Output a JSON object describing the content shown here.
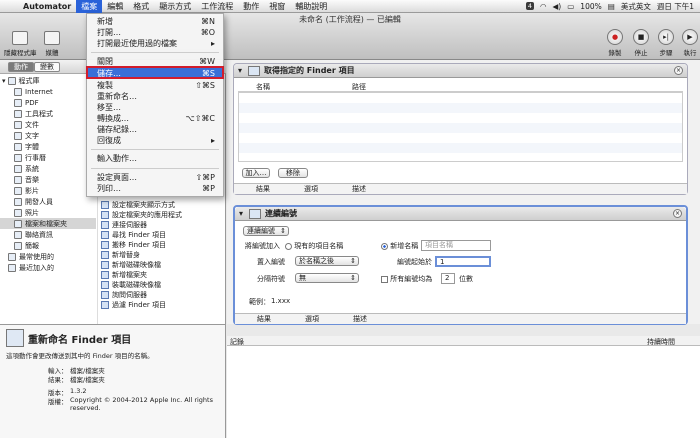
{
  "menubar": {
    "app": "Automator",
    "items": [
      "檔案",
      "編輯",
      "格式",
      "顯示方式",
      "工作流程",
      "動作",
      "視窗",
      "輔助說明"
    ],
    "right": {
      "num": "4",
      "battery": "100%",
      "input": "美式英文",
      "clock": "週日 下午1"
    }
  },
  "window": {
    "title": "未命名 (工作流程) — 已編輯"
  },
  "toolbar": {
    "library": "隱藏程式庫",
    "media": "媒體",
    "record": "錄製",
    "stop": "停止",
    "step": "步驟",
    "run": "執行"
  },
  "left_header": {
    "actions": "動作",
    "variables": "變數"
  },
  "library": {
    "root": "程式庫",
    "items": [
      "Internet",
      "PDF",
      "工具程式",
      "文件",
      "文字",
      "字體",
      "行事曆",
      "系統",
      "音樂",
      "影片",
      "開發人員",
      "照片",
      "檔案和檔案夾",
      "聯絡資訊",
      "簡報",
      "最常使用的",
      "最近加入的"
    ]
  },
  "action_list": [
    "設定檔案夾顯示方式",
    "設定檔案夾的應用程式",
    "連接伺服器",
    "尋找 Finder 項目",
    "搬移 Finder 項目",
    "新增替身",
    "新增磁碟映像檔",
    "新增檔案夾",
    "裝載磁碟映像檔",
    "詢問伺服器",
    "過濾 Finder 項目"
  ],
  "description": {
    "title": "重新命名 Finder 項目",
    "text": "這項動作會更改傳送到其中的 Finder 項目的名稱。",
    "input_label": "輸入：",
    "input_value": "檔案/檔案夾",
    "result_label": "結果：",
    "result_value": "檔案/檔案夾",
    "version_label": "版本：",
    "version_value": "1.3.2",
    "copyright_label": "版權：",
    "copyright_value": "Copyright © 2004-2012 Apple Inc.  All rights reserved."
  },
  "card1": {
    "title": "取得指定的 Finder 項目",
    "col_name": "名稱",
    "col_path": "路徑",
    "add": "加入…",
    "remove": "移除",
    "tabs": [
      "結果",
      "選項",
      "描述"
    ]
  },
  "card2": {
    "title": "連續編號",
    "mode_select": "連續編號",
    "add_number_to": "將編號加入",
    "existing_name": "現有的項目名稱",
    "new_name": "新增名稱",
    "name_placeholder": "項目名稱",
    "place_label": "置入編號",
    "place_value": "於名稱之後",
    "start_label": "編號起始於",
    "start_value": "1",
    "sep_label": "分隔符號",
    "sep_value": "無",
    "all_numbers": "所有編號均為",
    "digits_value": "2",
    "digits": "位數",
    "example_label": "範例：",
    "example_value": "1.xxx",
    "tabs": [
      "結果",
      "選項",
      "描述"
    ]
  },
  "log": {
    "col_log": "記錄",
    "col_time": "持續時間"
  },
  "file_menu": {
    "items": [
      {
        "label": "新增",
        "shortcut": "⌘N"
      },
      {
        "label": "打開…",
        "shortcut": "⌘O"
      },
      {
        "label": "打開最近使用過的檔案",
        "shortcut": "▸"
      },
      {
        "label": "關閉",
        "shortcut": "⌘W"
      },
      {
        "label": "儲存…",
        "shortcut": "⌘S"
      },
      {
        "label": "複製",
        "shortcut": "⇧⌘S"
      },
      {
        "label": "重新命名…",
        "shortcut": ""
      },
      {
        "label": "移至…",
        "shortcut": ""
      },
      {
        "label": "轉換成…",
        "shortcut": "⌥⇧⌘C"
      },
      {
        "label": "儲存紀錄…",
        "shortcut": ""
      },
      {
        "label": "回復成",
        "shortcut": "▸"
      },
      {
        "label": "輸入動作…",
        "shortcut": ""
      },
      {
        "label": "設定頁面…",
        "shortcut": "⇧⌘P"
      },
      {
        "label": "列印…",
        "shortcut": "⌘P"
      }
    ]
  },
  "colors": {
    "accent": "#2a62d9",
    "highlight_box": "#d21d2d"
  }
}
